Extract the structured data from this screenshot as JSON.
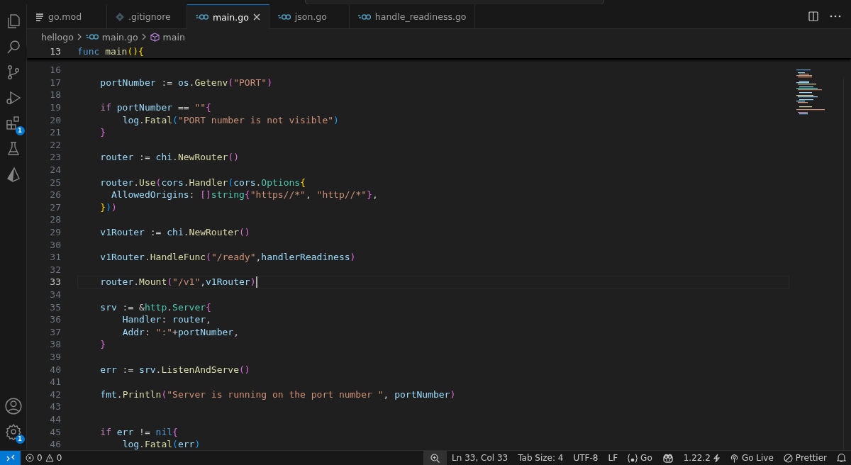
{
  "activity_bar": {
    "items": [
      {
        "kind": "files",
        "selected": false
      },
      {
        "kind": "search",
        "selected": false
      },
      {
        "kind": "source-control",
        "selected": false
      },
      {
        "kind": "run",
        "selected": false
      },
      {
        "kind": "extensions",
        "selected": false,
        "badge": "1"
      },
      {
        "kind": "testing",
        "selected": false
      },
      {
        "kind": "prism",
        "selected": false
      }
    ],
    "bottom_items": [
      {
        "kind": "account"
      },
      {
        "kind": "settings",
        "badge": "1"
      }
    ]
  },
  "tabs": [
    {
      "label": "go.mod",
      "kind": "mod",
      "selected": false
    },
    {
      "label": ".gitignore",
      "kind": "ignore",
      "selected": false
    },
    {
      "label": "main.go",
      "kind": "go",
      "selected": true
    },
    {
      "label": "json.go",
      "kind": "go",
      "selected": false
    },
    {
      "label": "handle_readiness.go",
      "kind": "go",
      "selected": false
    }
  ],
  "breadcrumb": [
    {
      "label": "hellogo",
      "kind": "folder"
    },
    {
      "label": "main.go",
      "kind": "go"
    },
    {
      "label": "main",
      "kind": "symbol"
    }
  ],
  "sticky_line": {
    "number": "13",
    "text": "func main(){"
  },
  "lines": [
    {
      "number": "16",
      "current": false
    },
    {
      "number": "17",
      "current": false,
      "text": "    portNumber := os.Getenv(\"PORT\")"
    },
    {
      "number": "18",
      "current": false
    },
    {
      "number": "19",
      "current": false,
      "text": "    if portNumber == \"\"{"
    },
    {
      "number": "20",
      "current": false,
      "text": "        log.Fatal(\"PORT number is not visible\")"
    },
    {
      "number": "21",
      "current": false,
      "text": "    }"
    },
    {
      "number": "22",
      "current": false
    },
    {
      "number": "23",
      "current": false,
      "text": "    router := chi.NewRouter()"
    },
    {
      "number": "24",
      "current": false
    },
    {
      "number": "25",
      "current": false,
      "text": "    router.Use(cors.Handler(cors.Options{"
    },
    {
      "number": "26",
      "current": false,
      "text": "      AllowedOrigins: []string{\"https//*\", \"http//*\"},"
    },
    {
      "number": "27",
      "current": false,
      "text": "    }))"
    },
    {
      "number": "28",
      "current": false
    },
    {
      "number": "29",
      "current": false,
      "text": "    v1Router := chi.NewRouter()"
    },
    {
      "number": "30",
      "current": false
    },
    {
      "number": "31",
      "current": false,
      "text": "    v1Router.HandleFunc(\"/ready\",handlerReadiness)"
    },
    {
      "number": "32",
      "current": false
    },
    {
      "number": "33",
      "current": true,
      "text": "    router.Mount(\"/v1\",v1Router)"
    },
    {
      "number": "34",
      "current": false
    },
    {
      "number": "35",
      "current": false,
      "text": "    srv := &http.Server{"
    },
    {
      "number": "36",
      "current": false,
      "text": "        Handler: router,"
    },
    {
      "number": "37",
      "current": false,
      "text": "        Addr: \":\"+portNumber,"
    },
    {
      "number": "38",
      "current": false,
      "text": "    }"
    },
    {
      "number": "39",
      "current": false
    },
    {
      "number": "40",
      "current": false,
      "text": "    err := srv.ListenAndServe()"
    },
    {
      "number": "41",
      "current": false
    },
    {
      "number": "42",
      "current": false,
      "text": "    fmt.Println(\"Server is running on the port number \", portNumber)"
    },
    {
      "number": "43",
      "current": false
    },
    {
      "number": "44",
      "current": false
    },
    {
      "number": "45",
      "current": false,
      "text": "    if err != nil{"
    },
    {
      "number": "46",
      "current": false,
      "text": "        log.Fatal(err)"
    }
  ],
  "status_bar": {
    "errors": "0",
    "warnings": "0",
    "right": [
      {
        "kind": "zoom"
      },
      {
        "kind": "text",
        "label": "Ln 33, Col 33"
      },
      {
        "kind": "text",
        "label": "Tab Size: 4"
      },
      {
        "kind": "text",
        "label": "UTF-8"
      },
      {
        "kind": "text",
        "label": "LF"
      },
      {
        "kind": "language",
        "label": "Go"
      },
      {
        "kind": "copilot"
      },
      {
        "kind": "version",
        "label": "1.22.2"
      },
      {
        "kind": "live",
        "label": "Go Live"
      },
      {
        "kind": "prettier",
        "label": "Prettier"
      },
      {
        "kind": "bell"
      }
    ]
  }
}
